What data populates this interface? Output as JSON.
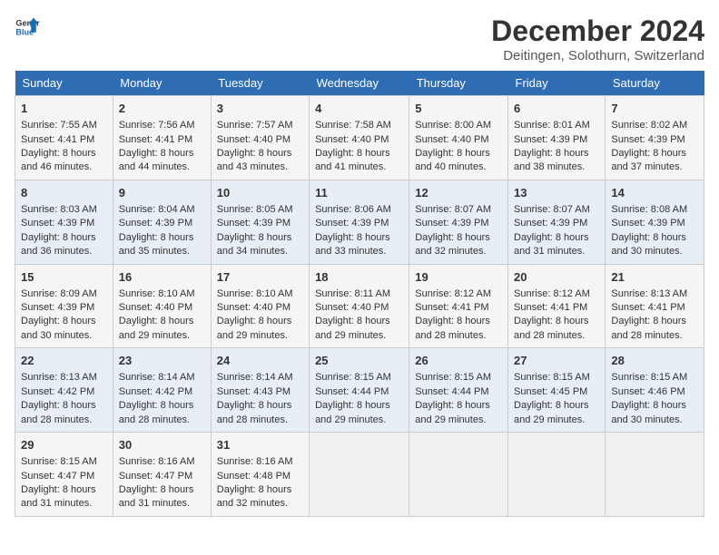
{
  "logo": {
    "line1": "General",
    "line2": "Blue"
  },
  "title": "December 2024",
  "subtitle": "Deitingen, Solothurn, Switzerland",
  "headers": [
    "Sunday",
    "Monday",
    "Tuesday",
    "Wednesday",
    "Thursday",
    "Friday",
    "Saturday"
  ],
  "weeks": [
    [
      {
        "day": "1",
        "sunrise": "Sunrise: 7:55 AM",
        "sunset": "Sunset: 4:41 PM",
        "daylight": "Daylight: 8 hours and 46 minutes."
      },
      {
        "day": "2",
        "sunrise": "Sunrise: 7:56 AM",
        "sunset": "Sunset: 4:41 PM",
        "daylight": "Daylight: 8 hours and 44 minutes."
      },
      {
        "day": "3",
        "sunrise": "Sunrise: 7:57 AM",
        "sunset": "Sunset: 4:40 PM",
        "daylight": "Daylight: 8 hours and 43 minutes."
      },
      {
        "day": "4",
        "sunrise": "Sunrise: 7:58 AM",
        "sunset": "Sunset: 4:40 PM",
        "daylight": "Daylight: 8 hours and 41 minutes."
      },
      {
        "day": "5",
        "sunrise": "Sunrise: 8:00 AM",
        "sunset": "Sunset: 4:40 PM",
        "daylight": "Daylight: 8 hours and 40 minutes."
      },
      {
        "day": "6",
        "sunrise": "Sunrise: 8:01 AM",
        "sunset": "Sunset: 4:39 PM",
        "daylight": "Daylight: 8 hours and 38 minutes."
      },
      {
        "day": "7",
        "sunrise": "Sunrise: 8:02 AM",
        "sunset": "Sunset: 4:39 PM",
        "daylight": "Daylight: 8 hours and 37 minutes."
      }
    ],
    [
      {
        "day": "8",
        "sunrise": "Sunrise: 8:03 AM",
        "sunset": "Sunset: 4:39 PM",
        "daylight": "Daylight: 8 hours and 36 minutes."
      },
      {
        "day": "9",
        "sunrise": "Sunrise: 8:04 AM",
        "sunset": "Sunset: 4:39 PM",
        "daylight": "Daylight: 8 hours and 35 minutes."
      },
      {
        "day": "10",
        "sunrise": "Sunrise: 8:05 AM",
        "sunset": "Sunset: 4:39 PM",
        "daylight": "Daylight: 8 hours and 34 minutes."
      },
      {
        "day": "11",
        "sunrise": "Sunrise: 8:06 AM",
        "sunset": "Sunset: 4:39 PM",
        "daylight": "Daylight: 8 hours and 33 minutes."
      },
      {
        "day": "12",
        "sunrise": "Sunrise: 8:07 AM",
        "sunset": "Sunset: 4:39 PM",
        "daylight": "Daylight: 8 hours and 32 minutes."
      },
      {
        "day": "13",
        "sunrise": "Sunrise: 8:07 AM",
        "sunset": "Sunset: 4:39 PM",
        "daylight": "Daylight: 8 hours and 31 minutes."
      },
      {
        "day": "14",
        "sunrise": "Sunrise: 8:08 AM",
        "sunset": "Sunset: 4:39 PM",
        "daylight": "Daylight: 8 hours and 30 minutes."
      }
    ],
    [
      {
        "day": "15",
        "sunrise": "Sunrise: 8:09 AM",
        "sunset": "Sunset: 4:39 PM",
        "daylight": "Daylight: 8 hours and 30 minutes."
      },
      {
        "day": "16",
        "sunrise": "Sunrise: 8:10 AM",
        "sunset": "Sunset: 4:40 PM",
        "daylight": "Daylight: 8 hours and 29 minutes."
      },
      {
        "day": "17",
        "sunrise": "Sunrise: 8:10 AM",
        "sunset": "Sunset: 4:40 PM",
        "daylight": "Daylight: 8 hours and 29 minutes."
      },
      {
        "day": "18",
        "sunrise": "Sunrise: 8:11 AM",
        "sunset": "Sunset: 4:40 PM",
        "daylight": "Daylight: 8 hours and 29 minutes."
      },
      {
        "day": "19",
        "sunrise": "Sunrise: 8:12 AM",
        "sunset": "Sunset: 4:41 PM",
        "daylight": "Daylight: 8 hours and 28 minutes."
      },
      {
        "day": "20",
        "sunrise": "Sunrise: 8:12 AM",
        "sunset": "Sunset: 4:41 PM",
        "daylight": "Daylight: 8 hours and 28 minutes."
      },
      {
        "day": "21",
        "sunrise": "Sunrise: 8:13 AM",
        "sunset": "Sunset: 4:41 PM",
        "daylight": "Daylight: 8 hours and 28 minutes."
      }
    ],
    [
      {
        "day": "22",
        "sunrise": "Sunrise: 8:13 AM",
        "sunset": "Sunset: 4:42 PM",
        "daylight": "Daylight: 8 hours and 28 minutes."
      },
      {
        "day": "23",
        "sunrise": "Sunrise: 8:14 AM",
        "sunset": "Sunset: 4:42 PM",
        "daylight": "Daylight: 8 hours and 28 minutes."
      },
      {
        "day": "24",
        "sunrise": "Sunrise: 8:14 AM",
        "sunset": "Sunset: 4:43 PM",
        "daylight": "Daylight: 8 hours and 28 minutes."
      },
      {
        "day": "25",
        "sunrise": "Sunrise: 8:15 AM",
        "sunset": "Sunset: 4:44 PM",
        "daylight": "Daylight: 8 hours and 29 minutes."
      },
      {
        "day": "26",
        "sunrise": "Sunrise: 8:15 AM",
        "sunset": "Sunset: 4:44 PM",
        "daylight": "Daylight: 8 hours and 29 minutes."
      },
      {
        "day": "27",
        "sunrise": "Sunrise: 8:15 AM",
        "sunset": "Sunset: 4:45 PM",
        "daylight": "Daylight: 8 hours and 29 minutes."
      },
      {
        "day": "28",
        "sunrise": "Sunrise: 8:15 AM",
        "sunset": "Sunset: 4:46 PM",
        "daylight": "Daylight: 8 hours and 30 minutes."
      }
    ],
    [
      {
        "day": "29",
        "sunrise": "Sunrise: 8:15 AM",
        "sunset": "Sunset: 4:47 PM",
        "daylight": "Daylight: 8 hours and 31 minutes."
      },
      {
        "day": "30",
        "sunrise": "Sunrise: 8:16 AM",
        "sunset": "Sunset: 4:47 PM",
        "daylight": "Daylight: 8 hours and 31 minutes."
      },
      {
        "day": "31",
        "sunrise": "Sunrise: 8:16 AM",
        "sunset": "Sunset: 4:48 PM",
        "daylight": "Daylight: 8 hours and 32 minutes."
      },
      null,
      null,
      null,
      null
    ]
  ]
}
